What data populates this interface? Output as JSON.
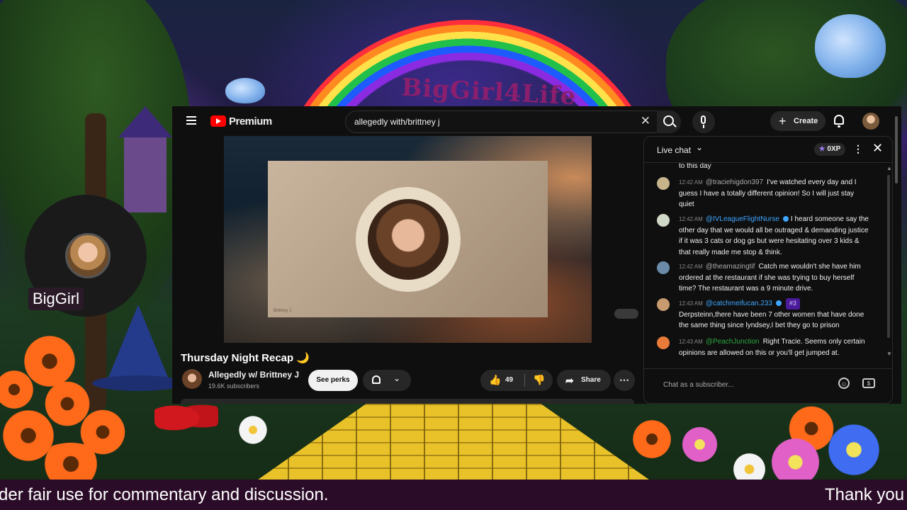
{
  "scene": {
    "channel_title": "BigGirl4Life",
    "streamer_name": "BigGirl"
  },
  "youtube": {
    "brand": "Premium",
    "search": {
      "query": "allegedly with/brittney j",
      "clear_icon": "close-icon"
    },
    "create_label": "Create",
    "video": {
      "title": "Thursday Night Recap 🌙",
      "watermark": "Brittney J"
    },
    "channel": {
      "name": "Allegedly w/ Brittney J",
      "subscribers": "19.6K subscribers"
    },
    "actions": {
      "perks_label": "See perks",
      "likes": "49",
      "share_label": "Share"
    },
    "chat": {
      "title": "Live chat",
      "xp": "0XP",
      "input_placeholder": "Chat as a subscriber...",
      "messages": [
        {
          "time": "",
          "author": "",
          "text": "to this day"
        },
        {
          "time": "12:42 AM",
          "author": "@traciehigdon397",
          "text": "I've watched every day and I guess I have a totally different opinion! So I will just stay quiet"
        },
        {
          "time": "12:42 AM",
          "author": "@IVLeagueFlightNurse",
          "text": "I heard someone say the other day that we would all be outraged & demanding justice if it was 3 cats or dog gs but were hesitating over 3 kids & that really made me stop & think."
        },
        {
          "time": "12:42 AM",
          "author": "@theamazingtif",
          "text": "Catch me wouldn't she have him ordered at the restaurant if she was trying to buy herself time? The restaurant was a 9 minute drive."
        },
        {
          "time": "12:43 AM",
          "author": "@catchmeifucan.233",
          "rank": "#3",
          "text": "Derpsteinn,there have been 7 other women that have done the same thing since lyndsey,I bet they go to prison"
        },
        {
          "time": "12:43 AM",
          "author": "@PeachJunction",
          "text": "Right Tracie. Seems only certain opinions are allowed on this or you'll get jumped at."
        }
      ]
    }
  },
  "ticker": {
    "left_text": "der fair use for commentary and discussion.",
    "right_text": "Thank you"
  },
  "colors": {
    "youtube_red": "#ff0000",
    "ticker_bg": "#2b0c28",
    "member_green": "#2ba640"
  }
}
